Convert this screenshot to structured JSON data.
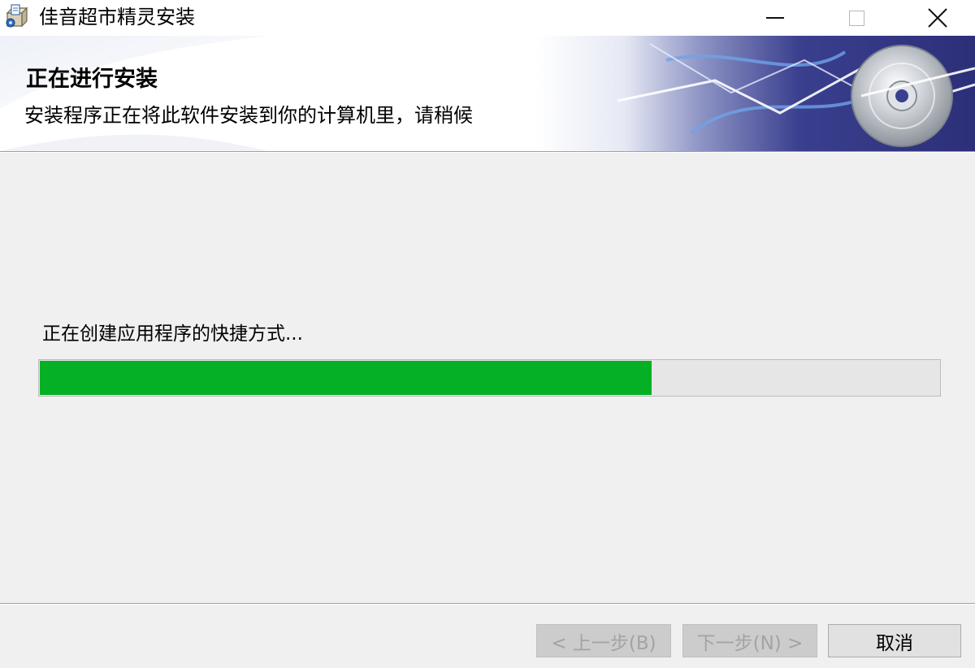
{
  "window": {
    "title": "佳音超市精灵安装",
    "icon": "installer-package-icon",
    "controls": {
      "minimize": "minimize-icon",
      "maximize": "maximize-icon",
      "close": "close-icon"
    }
  },
  "banner": {
    "title": "正在进行安装",
    "subtitle": "安装程序正在将此软件安装到你的计算机里，请稍候",
    "art_icon": "cd-disc-icon"
  },
  "main": {
    "status": "正在创建应用程序的快捷方式...",
    "progress_fraction": 0.68,
    "progress_color": "#06b025"
  },
  "footer": {
    "back_label": "< 上一步(B)",
    "next_label": "下一步(N) >",
    "cancel_label": "取消"
  }
}
